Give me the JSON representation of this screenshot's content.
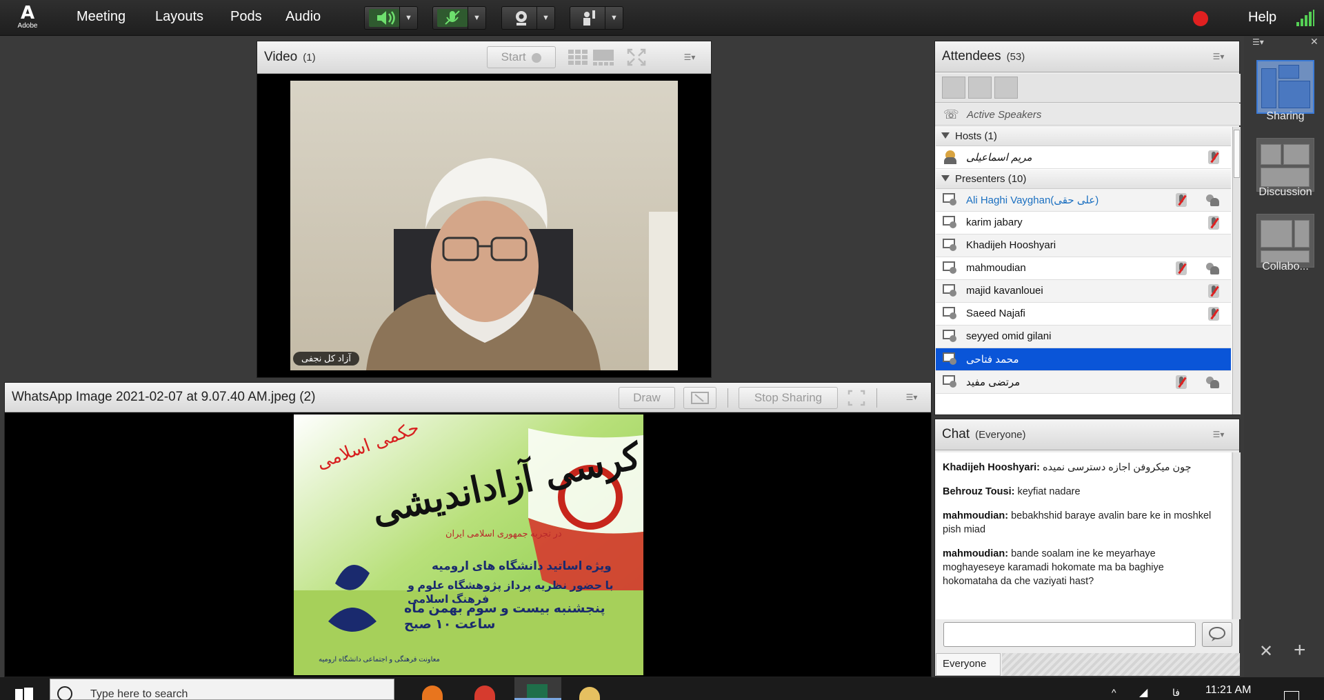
{
  "menubar": {
    "logo_text": "Adobe",
    "items": [
      "Meeting",
      "Layouts",
      "Pods",
      "Audio"
    ],
    "help_label": "Help",
    "icons": [
      "speaker-icon",
      "microphone-icon",
      "webcam-icon",
      "raise-hand-icon"
    ],
    "colors": {
      "accent_green": "#55d055",
      "record_red": "#e02020"
    }
  },
  "video_pod": {
    "title": "Video",
    "count": "(1)",
    "start_label": "Start",
    "name_tag": "آزاد کل نجفی"
  },
  "share_pod": {
    "title": "WhatsApp Image 2021-02-07 at 9.07.40 AM.jpeg (2)",
    "draw_label": "Draw",
    "stop_label": "Stop Sharing",
    "image": {
      "heading": "کرسی آزاداندیشی",
      "subheading": "حکمی اسلامی",
      "line1": "در تجربه جمهوری اسلامی ایران",
      "line2": "ویژه اساتید دانشگاه های ارومیه",
      "line3": "با حضور نظریه پرداز پژوهشگاه علوم و فرهنگ اسلامی",
      "line4": "پنجشنبه بیست و سوم بهمن ماه ساعت ۱۰ صبح",
      "footer": "معاونت فرهنگی و اجتماعی دانشگاه ارومیه"
    }
  },
  "attendees": {
    "title": "Attendees",
    "count": "(53)",
    "active_speakers": "Active Speakers",
    "hosts_label": "Hosts (1)",
    "hosts": [
      {
        "name": "مریم اسماعیلی",
        "mic_off": true,
        "cam": false
      }
    ],
    "presenters_label": "Presenters (10)",
    "presenters": [
      {
        "name": "Ali Haghi Vayghan(علی حقی)",
        "mic_off": true,
        "cam": true,
        "highlight": true,
        "selected": false
      },
      {
        "name": "karim jabary",
        "mic_off": true,
        "cam": false,
        "highlight": false,
        "selected": false
      },
      {
        "name": "Khadijeh Hooshyari",
        "mic_off": false,
        "cam": false,
        "highlight": false,
        "selected": false
      },
      {
        "name": "mahmoudian",
        "mic_off": true,
        "cam": true,
        "highlight": false,
        "selected": false
      },
      {
        "name": "majid kavanlouei",
        "mic_off": true,
        "cam": false,
        "highlight": false,
        "selected": false
      },
      {
        "name": "Saeed Najafi",
        "mic_off": true,
        "cam": false,
        "highlight": false,
        "selected": false
      },
      {
        "name": "seyyed omid gilani",
        "mic_off": false,
        "cam": false,
        "highlight": false,
        "selected": false
      },
      {
        "name": "محمد فتاحی",
        "mic_off": false,
        "cam": false,
        "highlight": false,
        "selected": true
      },
      {
        "name": "مرتضی مفید",
        "mic_off": true,
        "cam": true,
        "highlight": false,
        "selected": false
      }
    ]
  },
  "chat": {
    "title": "Chat",
    "scope": "(Everyone)",
    "messages": [
      {
        "author": "Khadijeh Hooshyari:",
        "text": "چون میکروفن اجازه دسترسی نمیده"
      },
      {
        "author": "Behrouz Tousi:",
        "text": "keyfiat nadare"
      },
      {
        "author": "mahmoudian:",
        "text": "bebakhshid baraye avalin bare ke in moshkel pish miad"
      },
      {
        "author": "mahmoudian:",
        "text": "bande soalam ine ke meyarhaye moghayeseye karamadi hokomate ma ba baghiye hokomataha da che vaziyati hast?"
      }
    ],
    "input_placeholder": "",
    "target_tab": "Everyone"
  },
  "layouts": [
    {
      "label": "Sharing",
      "active": true
    },
    {
      "label": "Discussion",
      "active": false
    },
    {
      "label": "Collabo...",
      "active": false
    }
  ],
  "taskbar": {
    "search_placeholder": "Type here to search",
    "lang": "فا",
    "time": "11:21 AM"
  }
}
